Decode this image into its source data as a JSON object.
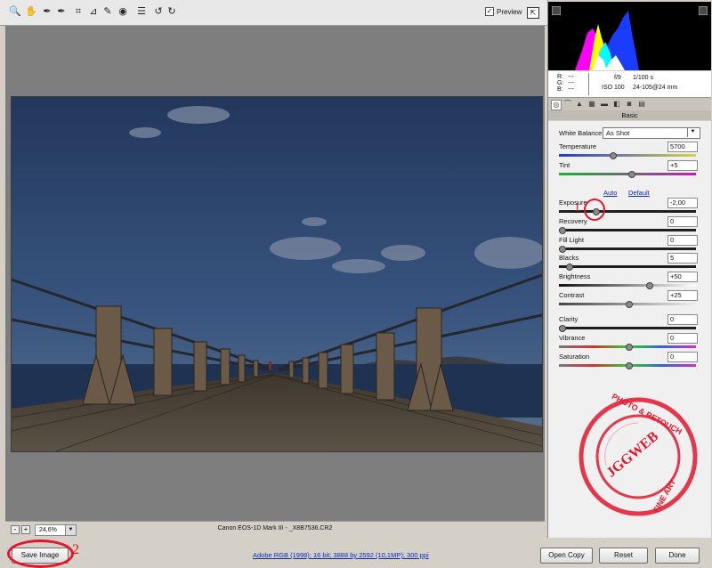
{
  "toolbar": {
    "tools": [
      {
        "icon": "zoom-icon",
        "glyph": "🔍"
      },
      {
        "icon": "hand-icon",
        "glyph": "✋"
      },
      {
        "icon": "white-balance-eyedropper-icon",
        "glyph": "✒"
      },
      {
        "icon": "color-sampler-icon",
        "glyph": "✒"
      },
      {
        "icon": "crop-icon",
        "glyph": "⌗"
      },
      {
        "icon": "straighten-icon",
        "glyph": "⊿"
      },
      {
        "icon": "retouch-icon",
        "glyph": "✎"
      },
      {
        "icon": "red-eye-icon",
        "glyph": "◉"
      },
      {
        "icon": "preferences-icon",
        "glyph": "☰"
      },
      {
        "icon": "rotate-left-icon",
        "glyph": "↺"
      },
      {
        "icon": "rotate-right-icon",
        "glyph": "↻"
      }
    ],
    "preview_label": "Preview",
    "preview_checked": "✓",
    "fullscreen_glyph": "⇱"
  },
  "status": {
    "zoom_minus": "-",
    "zoom_plus": "+",
    "zoom_value": "24,6%",
    "zoom_arrow": "▼",
    "filename": "Canon EOS-1D Mark III  -  _X8B7536.CR2"
  },
  "bottom": {
    "save_label": "Save Image",
    "workflow_link": "Adobe RGB (1998); 16 bit; 3888 by 2592 (10,1MP); 300 ppi",
    "open_label": "Open Copy",
    "reset_label": "Reset",
    "done_label": "Done"
  },
  "annotations": {
    "num1": "1",
    "num2": "2",
    "color": "#e3162b"
  },
  "camera": {
    "r_label": "R:",
    "r_value": "---",
    "g_label": "G:",
    "g_value": "---",
    "b_label": "B:",
    "b_value": "---",
    "aperture": "f/9",
    "shutter": "1/100 s",
    "iso": "ISO 100",
    "lens": "24-105@24 mm"
  },
  "panel": {
    "section_title": "Basic",
    "white_balance_label": "White Balance:",
    "white_balance_value": "As Shot",
    "auto_label": "Auto",
    "default_label": "Default",
    "sliders": [
      {
        "key": "temperature",
        "label": "Temperature",
        "value": "5700",
        "level": 0.38
      },
      {
        "key": "tint",
        "label": "Tint",
        "value": "+5",
        "level": 0.52
      },
      {
        "key": "exposure",
        "label": "Exposure",
        "value": "-2,00",
        "level": 0.25
      },
      {
        "key": "recovery",
        "label": "Recovery",
        "value": "0",
        "level": 0.0
      },
      {
        "key": "fill-light",
        "label": "Fill Light",
        "value": "0",
        "level": 0.0
      },
      {
        "key": "blacks",
        "label": "Blacks",
        "value": "5",
        "level": 0.05
      },
      {
        "key": "brightness",
        "label": "Brightness",
        "value": "+50",
        "level": 0.65
      },
      {
        "key": "contrast",
        "label": "Contrast",
        "value": "+25",
        "level": 0.5
      },
      {
        "key": "clarity",
        "label": "Clarity",
        "value": "0",
        "level": 0.0
      },
      {
        "key": "vibrance",
        "label": "Vibrance",
        "value": "0",
        "level": 0.5
      },
      {
        "key": "saturation",
        "label": "Saturation",
        "value": "0",
        "level": 0.5
      }
    ]
  },
  "watermark": {
    "top_text": "PHOTO & RETOUCH",
    "middle_text": "JGGWEB",
    "bottom_text": "FINE ART",
    "color": "#e3162b"
  }
}
